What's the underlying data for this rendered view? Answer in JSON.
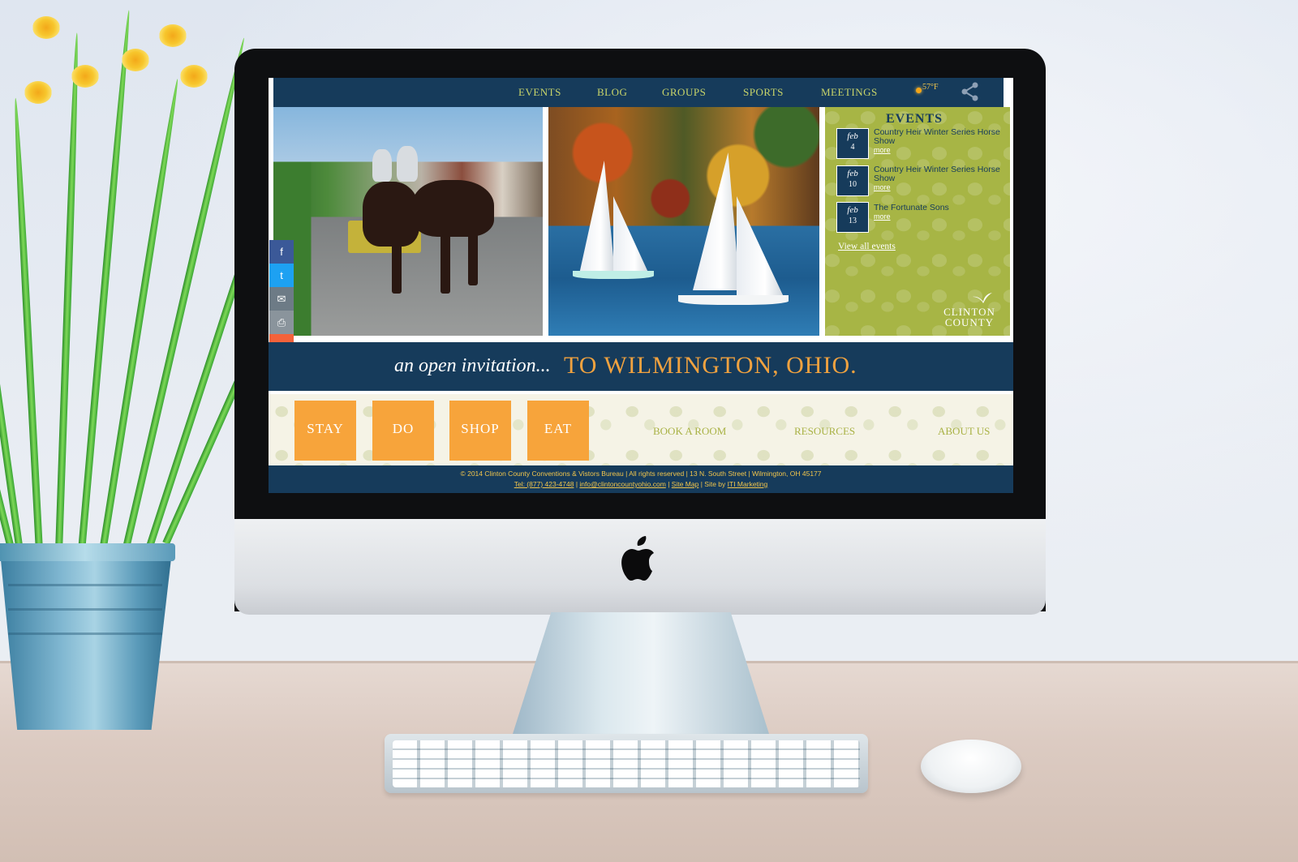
{
  "nav": {
    "items": [
      "EVENTS",
      "BLOG",
      "GROUPS",
      "SPORTS",
      "MEETINGS"
    ],
    "weather": "57°F"
  },
  "events": {
    "title": "EVENTS",
    "items": [
      {
        "month": "feb",
        "day": "4",
        "title": "Country Heir Winter Series Horse Show",
        "more": "more"
      },
      {
        "month": "feb",
        "day": "10",
        "title": "Country Heir Winter Series Horse Show",
        "more": "more"
      },
      {
        "month": "feb",
        "day": "13",
        "title": "The Fortunate Sons",
        "more": "more"
      }
    ],
    "view_all": "View all events"
  },
  "logo": {
    "line1": "CLINTON",
    "line2": "COUNTY"
  },
  "social": [
    "f",
    "t",
    "✉",
    "⎙",
    "+"
  ],
  "tagline": {
    "script": "an open invitation...",
    "main": "TO WILMINGTON, OHIO."
  },
  "tiles": [
    "STAY",
    "DO",
    "SHOP",
    "EAT"
  ],
  "links": [
    "BOOK A ROOM",
    "RESOURCES",
    "ABOUT US"
  ],
  "footer": {
    "line1": "© 2014 Clinton County Conventions & Vistors Bureau | All rights reserved | 13 N. South Street | Wilmington, OH 45177",
    "tel": "Tel: (877) 423-4748",
    "email": "info@clintoncountyohio.com",
    "sitemap": "Site Map",
    "siteby_prefix": "Site by",
    "siteby": "ITI Marketing"
  },
  "colors": {
    "navy": "#163b5b",
    "olive": "#a7b545",
    "orange": "#f7a43b",
    "gold": "#f1c54c"
  }
}
